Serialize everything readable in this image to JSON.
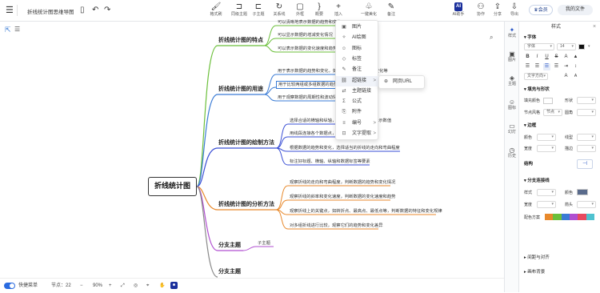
{
  "header": {
    "doc_title": "折线统计图思维导图",
    "tools": [
      {
        "name": "format-brush",
        "label": "格式刷",
        "glyph": "🖌"
      },
      {
        "name": "same-level-topic",
        "label": "同级主题",
        "glyph": "⊐"
      },
      {
        "name": "sub-topic",
        "label": "子主题",
        "glyph": "⊏"
      },
      {
        "name": "relation-line",
        "label": "关系线",
        "glyph": "↻"
      },
      {
        "name": "outline-frame",
        "label": "外框",
        "glyph": "▢"
      },
      {
        "name": "summary",
        "label": "概要",
        "glyph": "}"
      },
      {
        "name": "insert",
        "label": "插入",
        "glyph": "+"
      },
      {
        "name": "one-key-beautify",
        "label": "一键美化",
        "glyph": "♧"
      },
      {
        "name": "comment",
        "label": "备注",
        "glyph": "✎"
      }
    ],
    "ai_label": "AI助手",
    "collab_label": "协作",
    "share_label": "分享",
    "export_label": "导出",
    "vip_label": "会员",
    "my_files_label": "我的文件"
  },
  "mindmap": {
    "root": "折线统计图",
    "main_topics": [
      {
        "title": "折线统计图的特点",
        "color": "#6bbf3a",
        "children": [
          "可以清晰地表示数据的趋势和变化",
          "可以显示数据的增减变化情况",
          "可以表示数据的变化速度和趋势"
        ]
      },
      {
        "title": "折线统计图的用途",
        "color": "#3a7bd5",
        "children": [
          "用于表示数据的趋势和变化，如股票价格变化、天气变化等",
          "用于比较两组或多组数据的趋势和变化",
          "用于观察数据的周期性和波动情况"
        ]
      },
      {
        "title": "折线统计图的绘制方法",
        "color": "#3a4fd5",
        "children": [
          "选择合适的横轴和纵轴，横轴表示时间，纵轴表示数值",
          "用线段连接各个数据点，形成一条折线",
          "根据数据的趋势和变化，选择适当的折线的走向和弯曲程度",
          "标注好标题、横轴、纵轴和数据标签等要素"
        ]
      },
      {
        "title": "折线统计图的分析方法",
        "color": "#e8892c",
        "children": [
          "观察折线的走向和弯曲程度，判断数据的趋势和变化情况",
          "观察折线的斜率和变化速度，判断数据的变化速度和趋势",
          "观察折线上的关键点，如转折点、最高点、最低点等，判断数据的特征和变化规律",
          "对多组折线进行比较，观察它们的趋势和变化差异"
        ]
      },
      {
        "title": "分支主题",
        "color": "#b04fd0",
        "children": [
          "子主题"
        ]
      },
      {
        "title": "分支主题",
        "color": "#888888",
        "children": []
      }
    ]
  },
  "context_menu": {
    "items": [
      {
        "label": "图片",
        "icon": "image-icon",
        "arrow": ""
      },
      {
        "label": "AI绘图",
        "icon": "ai-draw-icon",
        "arrow": ""
      },
      {
        "label": "图标",
        "icon": "icon-icon",
        "arrow": ""
      },
      {
        "label": "标签",
        "icon": "tag-icon",
        "arrow": ""
      },
      {
        "label": "备注",
        "icon": "note-icon",
        "arrow": ""
      },
      {
        "label": "超链接",
        "icon": "link-icon",
        "arrow": ">"
      },
      {
        "label": "主题链接",
        "icon": "topic-link-icon",
        "arrow": ""
      },
      {
        "label": "公式",
        "icon": "formula-icon",
        "arrow": ""
      },
      {
        "label": "附件",
        "icon": "attachment-icon",
        "arrow": ""
      },
      {
        "label": "编号",
        "icon": "numbering-icon",
        "arrow": ">"
      },
      {
        "label": "文字提取",
        "icon": "text-extract-icon",
        "arrow": ">"
      }
    ],
    "submenu_label": "网页URL"
  },
  "right_rail": [
    {
      "label": "样式",
      "glyph": "✦"
    },
    {
      "label": "图片",
      "glyph": "▣"
    },
    {
      "label": "主题",
      "glyph": "◈"
    },
    {
      "label": "图标",
      "glyph": "☺"
    },
    {
      "label": "幻灯",
      "glyph": "▭"
    },
    {
      "label": "历史",
      "glyph": "◷"
    }
  ],
  "style_panel": {
    "title": "样式",
    "font_section": "字体",
    "font_family": "字体",
    "font_size": "14",
    "text_color_label": "文字方向",
    "border_section": "填充与形状",
    "fill_color_label": "填充颜色",
    "shape_label": "形状",
    "node_style_label": "节点风格",
    "node_style_value": "节点",
    "rounded_label": "圆角",
    "border_label": "边框",
    "color_label": "颜色",
    "line_type_label": "线型",
    "width_label": "宽度",
    "stroke_label": "描边",
    "structure_section": "结构",
    "branch_section": "分支连接线",
    "branch_style_label": "样式",
    "branch_color_label": "颜色",
    "branch_width_label": "宽度",
    "branch_arrow_label": "箭头",
    "palette_label": "配色方案",
    "palette": [
      "#e8892c",
      "#6bbf3a",
      "#3a7bd5",
      "#b04fd0",
      "#e84a5f",
      "#4fc2d0"
    ],
    "section_spacing": "间距与对齐",
    "section_canvas": "画布背景"
  },
  "footer": {
    "shortcut_label": "快捷菜单",
    "node_count_label": "节点：22",
    "zoom": "90%"
  }
}
